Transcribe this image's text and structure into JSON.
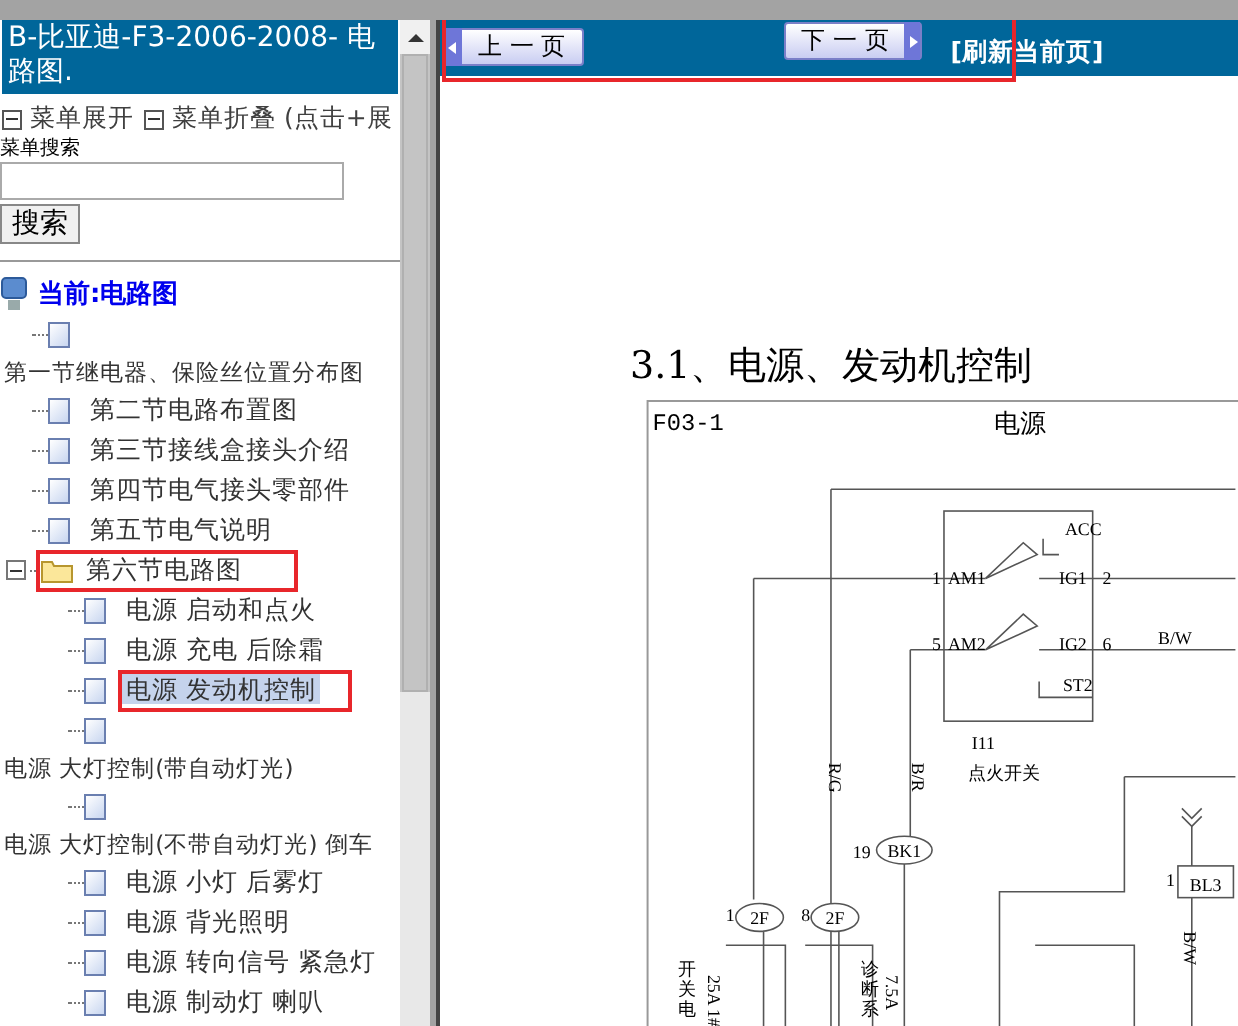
{
  "sidebar": {
    "title": "B-比亚迪-F3-2006-2008- 电路图.",
    "menu_links": [
      {
        "label": "菜单展开"
      },
      {
        "label": "菜单折叠 (点击+展"
      }
    ],
    "search": {
      "label": "菜单搜索",
      "button": "搜索"
    },
    "tree": [
      {
        "label": "当前:电路图",
        "kind": "root",
        "selected": false,
        "highlighted": false,
        "children": [
          {
            "label": "第一节继电器、保险丝位置分布图",
            "kind": "doc-wrapped",
            "selected": false,
            "highlighted": false
          },
          {
            "label": "第二节电路布置图",
            "kind": "doc",
            "selected": false,
            "highlighted": false
          },
          {
            "label": "第三节接线盒接头介绍",
            "kind": "doc",
            "selected": false,
            "highlighted": false
          },
          {
            "label": "第四节电气接头零部件",
            "kind": "doc",
            "selected": false,
            "highlighted": false
          },
          {
            "label": "第五节电气说明",
            "kind": "doc",
            "selected": false,
            "highlighted": false
          },
          {
            "label": "第六节电路图",
            "kind": "folder",
            "expanded": true,
            "selected": false,
            "highlighted": true,
            "children": [
              {
                "label": "电源 启动和点火",
                "kind": "doc",
                "selected": false,
                "highlighted": false
              },
              {
                "label": "电源 充电 后除霜",
                "kind": "doc",
                "selected": false,
                "highlighted": false
              },
              {
                "label": "电源 发动机控制",
                "kind": "doc",
                "selected": true,
                "highlighted": true
              },
              {
                "label": "电源 大灯控制(带自动灯光)",
                "kind": "doc-wrapped",
                "selected": false,
                "highlighted": false
              },
              {
                "label": "电源 大灯控制(不带自动灯光) 倒车",
                "kind": "doc-wrapped",
                "selected": false,
                "highlighted": false
              },
              {
                "label": "电源 小灯 后雾灯",
                "kind": "doc",
                "selected": false,
                "highlighted": false
              },
              {
                "label": "电源 背光照明",
                "kind": "doc",
                "selected": false,
                "highlighted": false
              },
              {
                "label": "电源 转向信号 紧急灯",
                "kind": "doc",
                "selected": false,
                "highlighted": false
              },
              {
                "label": "电源 制动灯 喇叭",
                "kind": "doc",
                "selected": false,
                "highlighted": false
              }
            ]
          }
        ]
      }
    ]
  },
  "toolbar": {
    "highlighted": true,
    "prev": "上 一 页",
    "next": "下 一 页",
    "refresh": "[刷新当前页]"
  },
  "content": {
    "heading": "3.1、电源、发动机控制",
    "diagram": {
      "code": "F03-1",
      "title": "电源",
      "labels": [
        {
          "text": "ACC",
          "kind": "h"
        },
        {
          "text": "1",
          "kind": "h"
        },
        {
          "text": "AM1",
          "kind": "h"
        },
        {
          "text": "IG1",
          "kind": "h"
        },
        {
          "text": "2",
          "kind": "h"
        },
        {
          "text": "5",
          "kind": "h"
        },
        {
          "text": "AM2",
          "kind": "h"
        },
        {
          "text": "IG2",
          "kind": "h"
        },
        {
          "text": "6",
          "kind": "h"
        },
        {
          "text": "B/W",
          "kind": "h"
        },
        {
          "text": "ST2",
          "kind": "h"
        },
        {
          "text": "I11",
          "kind": "h"
        },
        {
          "text": "点火开关",
          "kind": "h"
        },
        {
          "text": "R/G",
          "kind": "v"
        },
        {
          "text": "B/R",
          "kind": "v"
        },
        {
          "text": "19",
          "kind": "h"
        },
        {
          "text": "1",
          "kind": "h"
        },
        {
          "text": "8",
          "kind": "h"
        },
        {
          "text": "1",
          "kind": "h"
        },
        {
          "text": "B/W",
          "kind": "v"
        },
        {
          "text": "开关电",
          "kind": "vc"
        },
        {
          "text": "25A 1#",
          "kind": "v"
        },
        {
          "text": "诊断系",
          "kind": "vc"
        },
        {
          "text": "7.5A",
          "kind": "v"
        }
      ],
      "connectors": [
        {
          "text": "BK1"
        },
        {
          "text": "2F"
        },
        {
          "text": "2F"
        },
        {
          "text": "BL3"
        }
      ]
    }
  }
}
